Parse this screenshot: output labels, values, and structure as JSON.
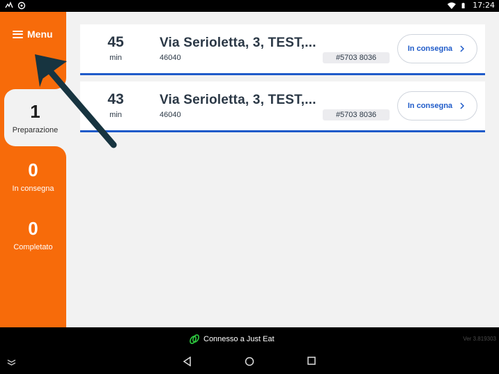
{
  "statusbar": {
    "time": "17:24",
    "icons": [
      "notification-icon",
      "antenna-icon",
      "wifi-icon",
      "battery-icon"
    ]
  },
  "sidebar": {
    "menu_label": "Menu",
    "items": [
      {
        "count": "1",
        "label": "Preparazione",
        "active": true
      },
      {
        "count": "0",
        "label": "In consegna",
        "active": false
      },
      {
        "count": "0",
        "label": "Completato",
        "active": false
      }
    ]
  },
  "orders": [
    {
      "minutes": "45",
      "unit": "min",
      "address": "Via Serioletta, 3, TEST,...",
      "zip": "46040",
      "code": "#5703 8036",
      "status": "In consegna"
    },
    {
      "minutes": "43",
      "unit": "min",
      "address": "Via Serioletta, 3, TEST,...",
      "zip": "46040",
      "code": "#5703 8036",
      "status": "In consegna"
    }
  ],
  "bottombar": {
    "connection_text": "Connesso a Just Eat",
    "version": "Ver 3.819303"
  },
  "colors": {
    "brand_orange": "#f76b0a",
    "accent_blue": "#1f5bc9",
    "text_dark": "#2b3846",
    "connection_green": "#2ecc40",
    "annotation_arrow": "#173440"
  }
}
